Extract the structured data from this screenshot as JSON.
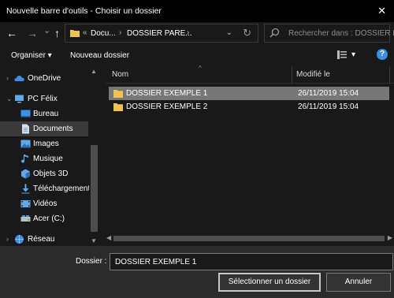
{
  "window": {
    "title": "Nouvelle barre d'outils - Choisir un dossier",
    "close_glyph": "✕"
  },
  "nav": {
    "back_glyph": "←",
    "forward_glyph": "→",
    "history_glyph": "⌄",
    "up_glyph": "↑",
    "breadcrumb": [
      {
        "label": "Docu..."
      },
      {
        "label": "DOSSIER PARE..."
      }
    ],
    "breadcrumb_sep_glyph": "›",
    "overflow_glyph": "«",
    "refresh_glyph": "↻",
    "search_placeholder": "Rechercher dans : DOSSIER P..."
  },
  "toolbar": {
    "organize_label": "Organiser ▾",
    "new_folder_label": "Nouveau dossier",
    "view_dd_glyph": "▾",
    "help_glyph": "?"
  },
  "sidebar": {
    "items": [
      {
        "label": "OneDrive",
        "icon": "onedrive-icon",
        "chevron": "›"
      },
      {
        "label": "PC Félix",
        "icon": "pc-icon",
        "chevron": "⌄"
      },
      {
        "label": "Bureau",
        "icon": "desktop-icon"
      },
      {
        "label": "Documents",
        "icon": "documents-icon",
        "selected": true
      },
      {
        "label": "Images",
        "icon": "images-icon"
      },
      {
        "label": "Musique",
        "icon": "music-icon"
      },
      {
        "label": "Objets 3D",
        "icon": "objects3d-icon"
      },
      {
        "label": "Téléchargements",
        "icon": "downloads-icon"
      },
      {
        "label": "Vidéos",
        "icon": "videos-icon"
      },
      {
        "label": "Acer (C:)",
        "icon": "drive-icon"
      },
      {
        "label": "Réseau",
        "icon": "network-icon",
        "chevron": "›"
      }
    ]
  },
  "files": {
    "columns": [
      "Nom",
      "Modifié le"
    ],
    "rows": [
      {
        "name": "DOSSIER EXEMPLE 1",
        "modified": "26/11/2019 15:04",
        "selected": true
      },
      {
        "name": "DOSSIER EXEMPLE 2",
        "modified": "26/11/2019 15:04",
        "selected": false
      }
    ]
  },
  "footer": {
    "folder_label": "Dossier :",
    "folder_value": "DOSSIER EXEMPLE 1",
    "select_button": "Sélectionner un dossier",
    "cancel_button": "Annuler"
  },
  "colors": {
    "background": "#191919",
    "footer": "#2b2b2b",
    "selection": "#777777",
    "sidebar_selection": "#3a3a3a",
    "folder": "#f1c34b",
    "accent": "#3c8ee6"
  }
}
